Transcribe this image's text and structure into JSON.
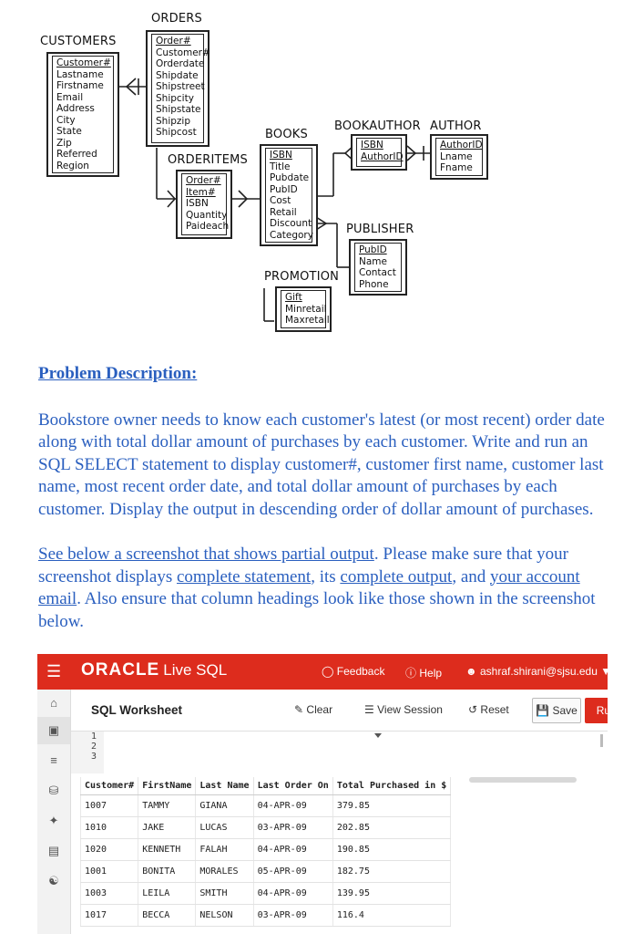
{
  "erd": {
    "entities": {
      "orders": {
        "title": "ORDERS",
        "fields": [
          "Order#",
          "Customer#",
          "Orderdate",
          "Shipdate",
          "Shipstreet",
          "Shipcity",
          "Shipstate",
          "Shipzip",
          "Shipcost"
        ],
        "pk": [
          0
        ]
      },
      "customers": {
        "title": "CUSTOMERS",
        "fields": [
          "Customer#",
          "Lastname",
          "Firstname",
          "Email",
          "Address",
          "City",
          "State",
          "Zip",
          "Referred",
          "Region"
        ],
        "pk": [
          0
        ]
      },
      "orderitems": {
        "title": "ORDERITEMS",
        "fields": [
          "Order#",
          "Item#",
          "ISBN",
          "Quantity",
          "Paideach"
        ],
        "pk": [
          0,
          1
        ]
      },
      "books": {
        "title": "BOOKS",
        "fields": [
          "ISBN",
          "Title",
          "Pubdate",
          "PubID",
          "Cost",
          "Retail",
          "Discount",
          "Category"
        ],
        "pk": [
          0
        ]
      },
      "bookauthor": {
        "title": "BOOKAUTHOR",
        "fields": [
          "ISBN",
          "AuthorID"
        ],
        "pk": [
          0,
          1
        ]
      },
      "author": {
        "title": "AUTHOR",
        "fields": [
          "AuthorID",
          "Lname",
          "Fname"
        ],
        "pk": [
          0
        ]
      },
      "publisher": {
        "title": "PUBLISHER",
        "fields": [
          "PubID",
          "Name",
          "Contact",
          "Phone"
        ],
        "pk": [
          0
        ]
      },
      "promotion": {
        "title": "PROMOTION",
        "fields": [
          "Gift",
          "Minretail",
          "Maxretail"
        ],
        "pk": [
          0
        ]
      }
    }
  },
  "doc": {
    "heading": "Problem Description:",
    "para1": "Bookstore owner needs to know each customer's latest (or most recent) order date along with total dollar amount of purchases by each customer. Write and run an SQL SELECT statement to display customer#, customer first name, customer last name, most recent order date, and total dollar amount of purchases by each customer. Display the output in descending order of dollar amount of purchases.",
    "para2_link1": "See below a screenshot that shows partial output",
    "para2_text1": ".  Please make sure that your screenshot displays ",
    "para2_link2": "complete statement",
    "para2_text2": ", its ",
    "para2_link3": "complete output",
    "para2_text3": ", and ",
    "para2_link4": "your account email",
    "para2_text4": ". Also ensure that column headings look like those shown in the screenshot below."
  },
  "app": {
    "brand": "ORACLE",
    "brand_sub": "Live SQL",
    "topbar": {
      "feedback": "Feedback",
      "help": "Help",
      "user": "ashraf.shirani@sjsu.edu"
    },
    "toolbar": {
      "title": "SQL Worksheet",
      "clear": "Clear",
      "view_session": "View Session",
      "reset": "Reset",
      "save": "Save",
      "run": "Run"
    },
    "editor": {
      "line_numbers": [
        "1",
        "2",
        "3"
      ]
    },
    "results": {
      "columns": [
        "Customer#",
        "FirstName",
        "Last Name",
        "Last Order On",
        "Total Purchased in $"
      ],
      "rows": [
        [
          "1007",
          "TAMMY",
          "GIANA",
          "04-APR-09",
          "379.85"
        ],
        [
          "1010",
          "JAKE",
          "LUCAS",
          "03-APR-09",
          "202.85"
        ],
        [
          "1020",
          "KENNETH",
          "FALAH",
          "04-APR-09",
          "190.85"
        ],
        [
          "1001",
          "BONITA",
          "MORALES",
          "05-APR-09",
          "182.75"
        ],
        [
          "1003",
          "LEILA",
          "SMITH",
          "04-APR-09",
          "139.95"
        ],
        [
          "1017",
          "BECCA",
          "NELSON",
          "03-APR-09",
          "116.4"
        ]
      ]
    }
  }
}
